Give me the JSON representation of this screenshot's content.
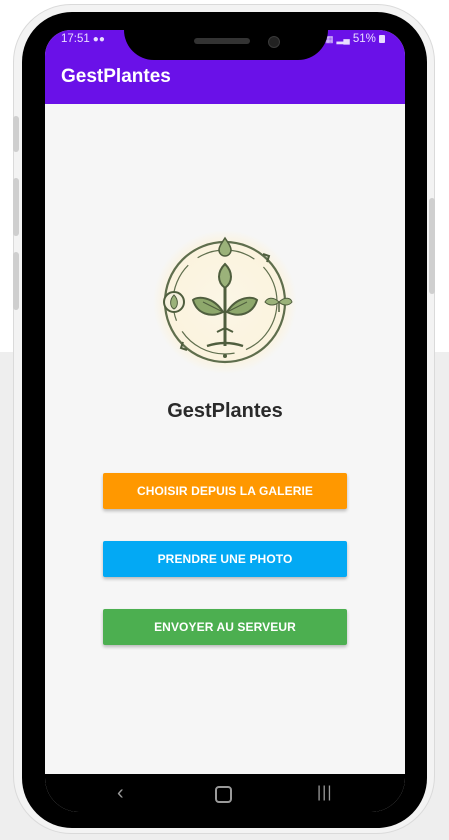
{
  "status_bar": {
    "time": "17:51",
    "battery": "51%"
  },
  "app_bar": {
    "title": "GestPlantes",
    "color": "#6a11e8"
  },
  "main": {
    "logo_icon": "plant-cycle-logo",
    "brand_name": "GestPlantes",
    "buttons": [
      {
        "label": "CHOISIR DEPUIS LA GALERIE",
        "color": "#ff9800"
      },
      {
        "label": "PRENDRE UNE PHOTO",
        "color": "#03a9f4"
      },
      {
        "label": "ENVOYER AU SERVEUR",
        "color": "#4caf50"
      }
    ]
  },
  "nav_bar": {
    "icons": [
      "back-icon",
      "home-icon",
      "recents-icon"
    ]
  }
}
